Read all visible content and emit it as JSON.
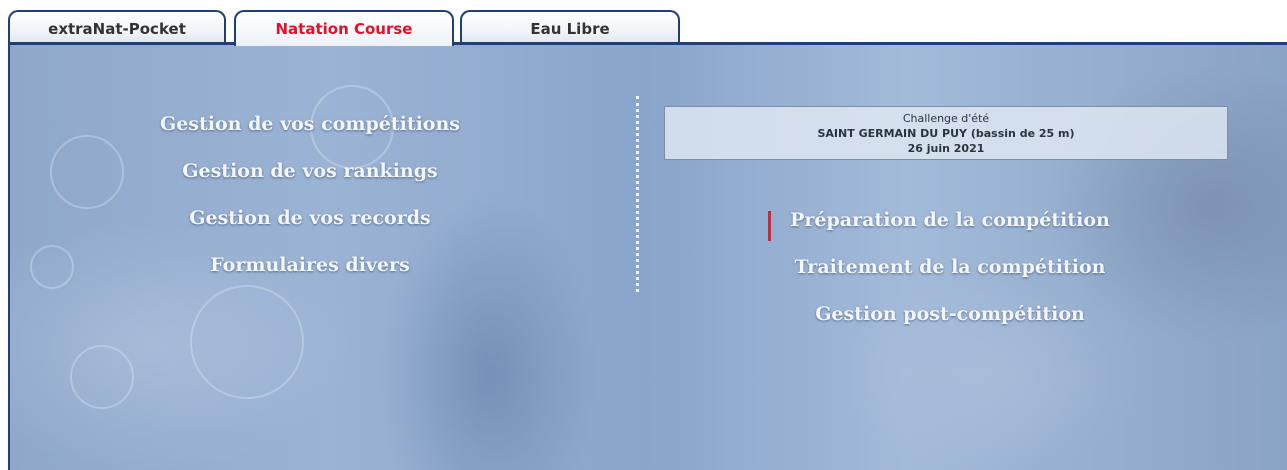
{
  "tabs": [
    {
      "label": "extraNat-Pocket",
      "active": false
    },
    {
      "label": "Natation Course",
      "active": true
    },
    {
      "label": "Eau Libre",
      "active": false
    }
  ],
  "left_menu": [
    {
      "label": "Gestion de vos compétitions"
    },
    {
      "label": "Gestion de vos rankings"
    },
    {
      "label": "Gestion de vos records"
    },
    {
      "label": "Formulaires divers"
    }
  ],
  "competition": {
    "name": "Challenge d'été",
    "location": "SAINT GERMAIN DU PUY (bassin de 25 m)",
    "date": "26 juin 2021"
  },
  "right_menu": [
    {
      "label": "Préparation de la compétition",
      "selected": true
    },
    {
      "label": "Traitement de la compétition"
    },
    {
      "label": "Gestion post-compétition"
    }
  ],
  "colors": {
    "tab_border": "#1e3f7a",
    "active_tab_text": "#e2102a",
    "menu_text": "#f3f6fb",
    "selection_marker": "#d4262c"
  }
}
